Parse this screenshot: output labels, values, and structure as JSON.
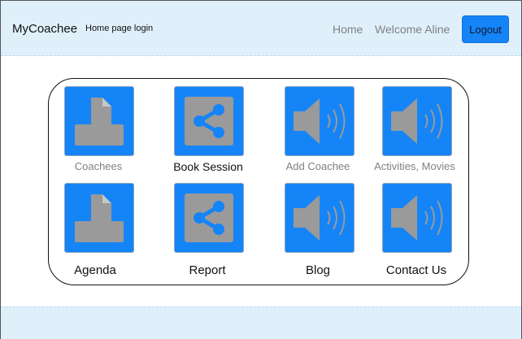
{
  "header": {
    "brand": "MyCoachee",
    "subtitle": "Home page login",
    "nav_home": "Home",
    "welcome": "Welcome Aline",
    "logout": "Logout"
  },
  "tiles": [
    {
      "label": "Coachees",
      "icon": "document-printer-icon"
    },
    {
      "label": "Book Session",
      "icon": "share-icon"
    },
    {
      "label": "Add Coachee",
      "icon": "speaker-icon"
    },
    {
      "label": "Activities, Movies",
      "icon": "speaker-icon"
    },
    {
      "label": "Agenda",
      "icon": "document-printer-icon"
    },
    {
      "label": "Report",
      "icon": "share-icon"
    },
    {
      "label": "Blog",
      "icon": "speaker-icon"
    },
    {
      "label": "Contact Us",
      "icon": "speaker-icon"
    }
  ],
  "colors": {
    "accent": "#1584f7",
    "header_bg": "#dff0fb",
    "icon_grey": "#9a9a9a"
  }
}
